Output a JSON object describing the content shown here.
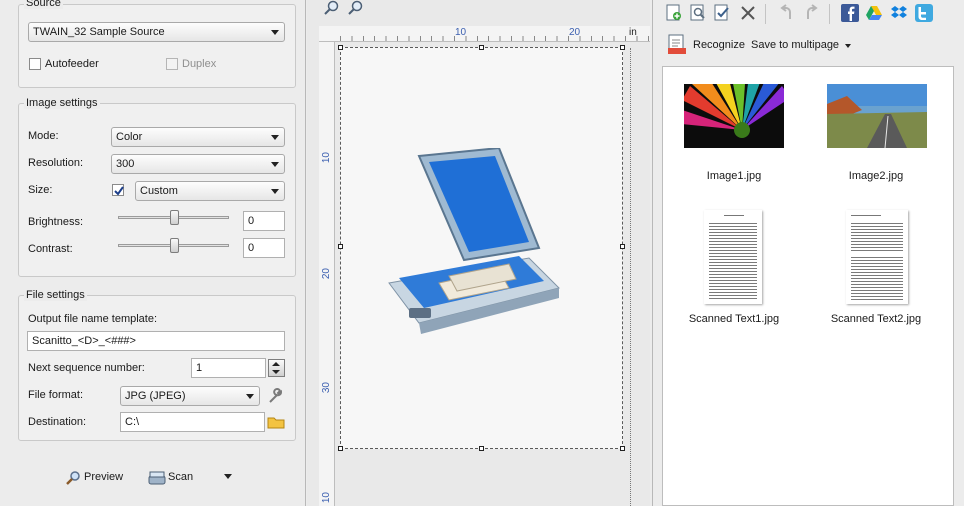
{
  "source": {
    "title": "Source",
    "scanner": "TWAIN_32 Sample Source",
    "autofeeder_label": "Autofeeder",
    "duplex_label": "Duplex"
  },
  "image_settings": {
    "title": "Image settings",
    "mode_label": "Mode:",
    "mode_value": "Color",
    "resolution_label": "Resolution:",
    "resolution_value": "300",
    "size_label": "Size:",
    "size_value": "Custom",
    "size_checked": true,
    "brightness_label": "Brightness:",
    "brightness_value": "0",
    "contrast_label": "Contrast:",
    "contrast_value": "0"
  },
  "file_settings": {
    "title": "File settings",
    "template_label": "Output file name template:",
    "template_value": "Scanitto_<D>_<###>",
    "seq_label": "Next sequence number:",
    "seq_value": "1",
    "format_label": "File format:",
    "format_value": "JPG (JPEG)",
    "destination_label": "Destination:",
    "destination_value": "C:\\"
  },
  "actions": {
    "preview_label": "Preview",
    "scan_label": "Scan"
  },
  "ruler": {
    "unit": "in",
    "h_ticks": [
      "10",
      "20"
    ],
    "v_ticks": [
      "10",
      "20",
      "30",
      "10"
    ]
  },
  "right_toolbar": {
    "recognize_label": "Recognize",
    "save_multipage_label": "Save to multipage"
  },
  "thumbnails": [
    {
      "name": "Image1.jpg",
      "kind": "flower-photo"
    },
    {
      "name": "Image2.jpg",
      "kind": "road-photo"
    },
    {
      "name": "Scanned Text1.jpg",
      "kind": "text-doc"
    },
    {
      "name": "Scanned Text2.jpg",
      "kind": "text-doc"
    }
  ],
  "colors": {
    "accent_blue": "#2a6fbf",
    "ruler_text": "#3b5fb0",
    "scanner_lid": "#1f6fd6"
  }
}
